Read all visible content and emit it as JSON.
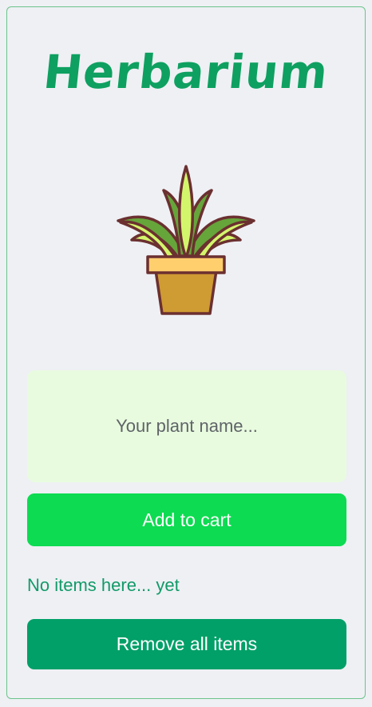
{
  "app": {
    "title": "Herbarium",
    "logo_icon": "potted-plant-icon"
  },
  "form": {
    "plant_name_value": "",
    "plant_name_placeholder": "Your plant name...",
    "add_button_label": "Add to cart"
  },
  "cart": {
    "empty_message": "No items here... yet",
    "remove_all_label": "Remove all items"
  },
  "colors": {
    "background": "#eef0f4",
    "border": "#6cc48c",
    "title": "#0ea060",
    "input_bg": "#e8fbdf",
    "add_button": "#0ddb51",
    "remove_button": "#00a068",
    "status_text": "#129a68"
  }
}
